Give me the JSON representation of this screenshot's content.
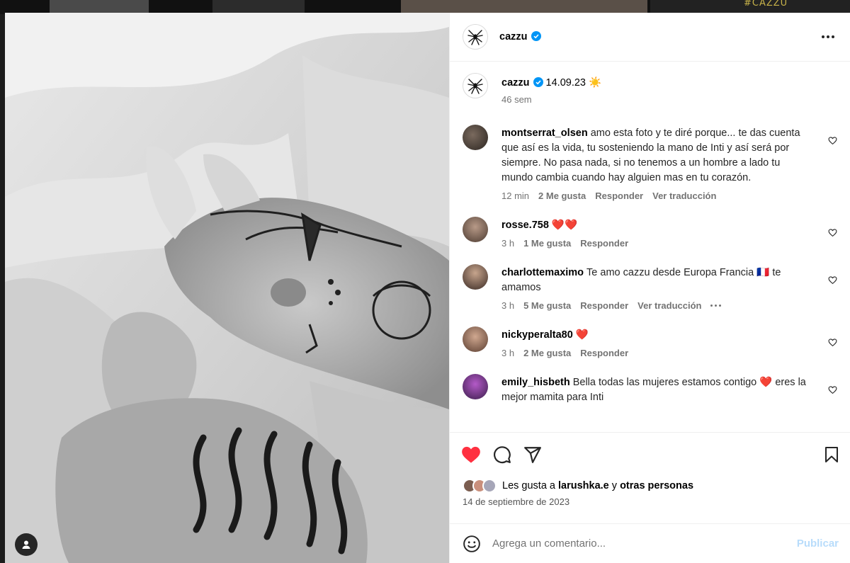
{
  "background": {
    "tile_text": "#CAZZU"
  },
  "post": {
    "author": "cazzu",
    "caption_text": "14.09.23 ☀️",
    "caption_age": "46 sem",
    "liked_by_prefix": "Les gusta a ",
    "liked_by_user": "larushka.e",
    "liked_by_and": " y ",
    "liked_by_others": "otras personas",
    "date": "14 de septiembre de 2023"
  },
  "comments": [
    {
      "user": "montserrat_olsen",
      "text": "amo esta foto y te diré porque... te das cuenta que así es la vida, tu sosteniendo la mano de Inti y así será por siempre. No pasa nada, si no tenemos a un hombre a lado tu mundo cambia cuando hay alguien mas en tu corazón.",
      "time": "12 min",
      "likes": "2 Me gusta",
      "reply": "Responder",
      "translate": "Ver traducción"
    },
    {
      "user": "rosse.758",
      "text": "❤️❤️",
      "time": "3 h",
      "likes": "1 Me gusta",
      "reply": "Responder"
    },
    {
      "user": "charlottemaximo",
      "text": "Te amo cazzu desde Europa Francia 🇫🇷 te amamos",
      "time": "3 h",
      "likes": "5 Me gusta",
      "reply": "Responder",
      "translate": "Ver traducción"
    },
    {
      "user": "nickyperalta80",
      "text": "❤️",
      "time": "3 h",
      "likes": "2 Me gusta",
      "reply": "Responder"
    },
    {
      "user": "emily_hisbeth",
      "text": "Bella todas las mujeres estamos contigo ❤️ eres la mejor mamita para Inti"
    }
  ],
  "comment_box": {
    "placeholder": "Agrega un comentario...",
    "publish_label": "Publicar"
  },
  "icons": {
    "heart": "heart-filled-icon",
    "comment": "comment-icon",
    "share": "share-icon",
    "save": "bookmark-icon",
    "emoji": "emoji-icon",
    "verified": "verified-badge-icon",
    "more": "more-options-icon",
    "user_tag": "user-tag-icon"
  },
  "colors": {
    "like_red": "#ff3040",
    "verified_blue": "#0095f6",
    "publish_disabled": "#b8dcfb",
    "meta_gray": "#737373"
  }
}
